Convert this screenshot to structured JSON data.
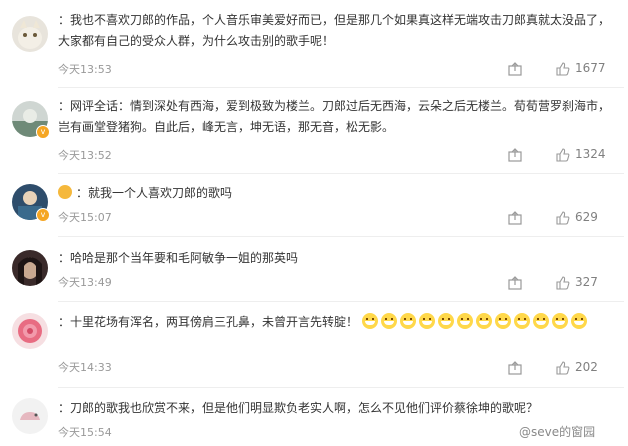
{
  "comments": [
    {
      "user": "",
      "text": "我也不喜欢刀郎的作品，个人音乐审美爱好而已，但是那几个如果真这样无端攻击刀郎真就太没品了，大家都有自己的受众人群，为什么攻击别的歌手呢！",
      "time": "今天13:53",
      "likes": "1677"
    },
    {
      "user": "",
      "text": "网评全话：情到深处有西海，爱到极致为楼兰。刀郎过后无西海，云朵之后无楼兰。荀荀营罗刹海市，岂有画堂登猪狗。自此后，峰无言，坤无语，那无音，松无影。",
      "time": "今天13:52",
      "likes": "1324"
    },
    {
      "user": "",
      "text": "就我一个人喜欢刀郎的歌吗",
      "time": "今天15:07",
      "likes": "629"
    },
    {
      "user": "",
      "text": "哈哈是那个当年要和毛阿敏争一姐的那英吗",
      "time": "今天13:49",
      "likes": "327"
    },
    {
      "user": "",
      "text": "十里花场有浑名，两耳傍肩三孔鼻，未曾开言先转腚！",
      "time": "今天14:33",
      "likes": "202"
    },
    {
      "user": "",
      "text": "刀郎的歌我也欣赏不来，但是他们明显欺负老实人啊，怎么不见他们评价蔡徐坤的歌呢？",
      "time": "今天15:54",
      "likes": ""
    }
  ],
  "separator": "：",
  "watermark": "@seve的窗园",
  "icons": {
    "share": "share-icon",
    "like": "thumbs-up-icon",
    "emoji": "grin-emoji-icon"
  },
  "colors": {
    "username": "#eb7350",
    "time": "#999999",
    "text": "#333333",
    "verified": "#f5a623"
  }
}
